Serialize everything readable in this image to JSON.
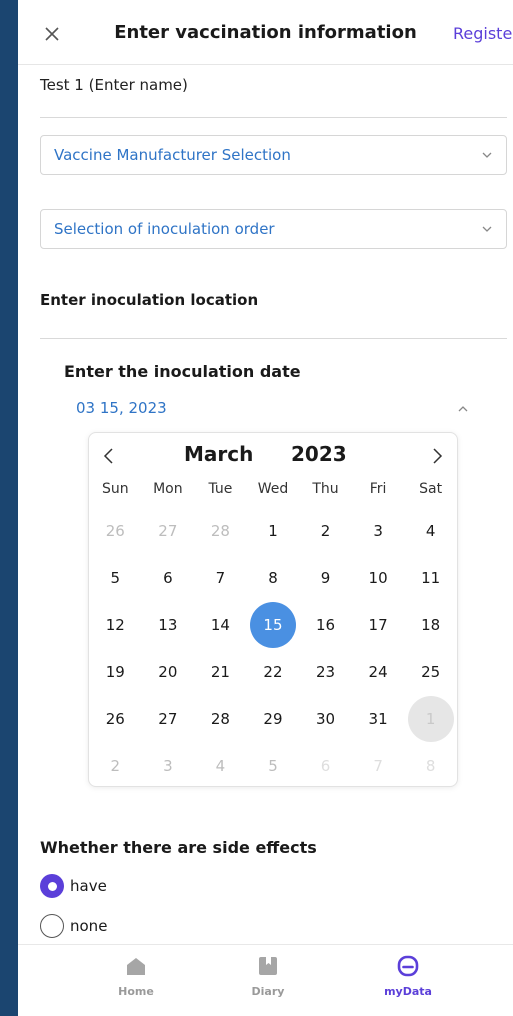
{
  "header": {
    "title": "Enter vaccination information",
    "register_label": "Register"
  },
  "form": {
    "name_value": "Test 1 (Enter name)",
    "manufacturer_select": "Vaccine Manufacturer Selection",
    "order_select": "Selection of inoculation order",
    "location_label": "Enter inoculation location",
    "date_label": "Enter the inoculation date",
    "date_value": "03 15, 2023"
  },
  "calendar": {
    "month": "March",
    "year": "2023",
    "weekdays": [
      "Sun",
      "Mon",
      "Tue",
      "Wed",
      "Thu",
      "Fri",
      "Sat"
    ],
    "weeks": [
      [
        "26",
        "27",
        "28",
        "1",
        "2",
        "3",
        "4"
      ],
      [
        "5",
        "6",
        "7",
        "8",
        "9",
        "10",
        "11"
      ],
      [
        "12",
        "13",
        "14",
        "15",
        "16",
        "17",
        "18"
      ],
      [
        "19",
        "20",
        "21",
        "22",
        "23",
        "24",
        "25"
      ],
      [
        "26",
        "27",
        "28",
        "29",
        "30",
        "31",
        "1"
      ],
      [
        "2",
        "3",
        "4",
        "5",
        "6",
        "7",
        "8"
      ]
    ],
    "selected_day": "15"
  },
  "side_effects": {
    "title": "Whether there are side effects",
    "options": [
      "have",
      "none"
    ],
    "selected": "have"
  },
  "nav": {
    "items": [
      {
        "label": "Home",
        "icon": "home-icon"
      },
      {
        "label": "Diary",
        "icon": "diary-icon"
      },
      {
        "label": "myData",
        "icon": "mydata-icon"
      }
    ],
    "active": "myData"
  },
  "colors": {
    "accent": "#5b3fd9",
    "link_blue": "#2f74c6",
    "selected_day": "#4a90e2",
    "frame": "#1b4570"
  }
}
